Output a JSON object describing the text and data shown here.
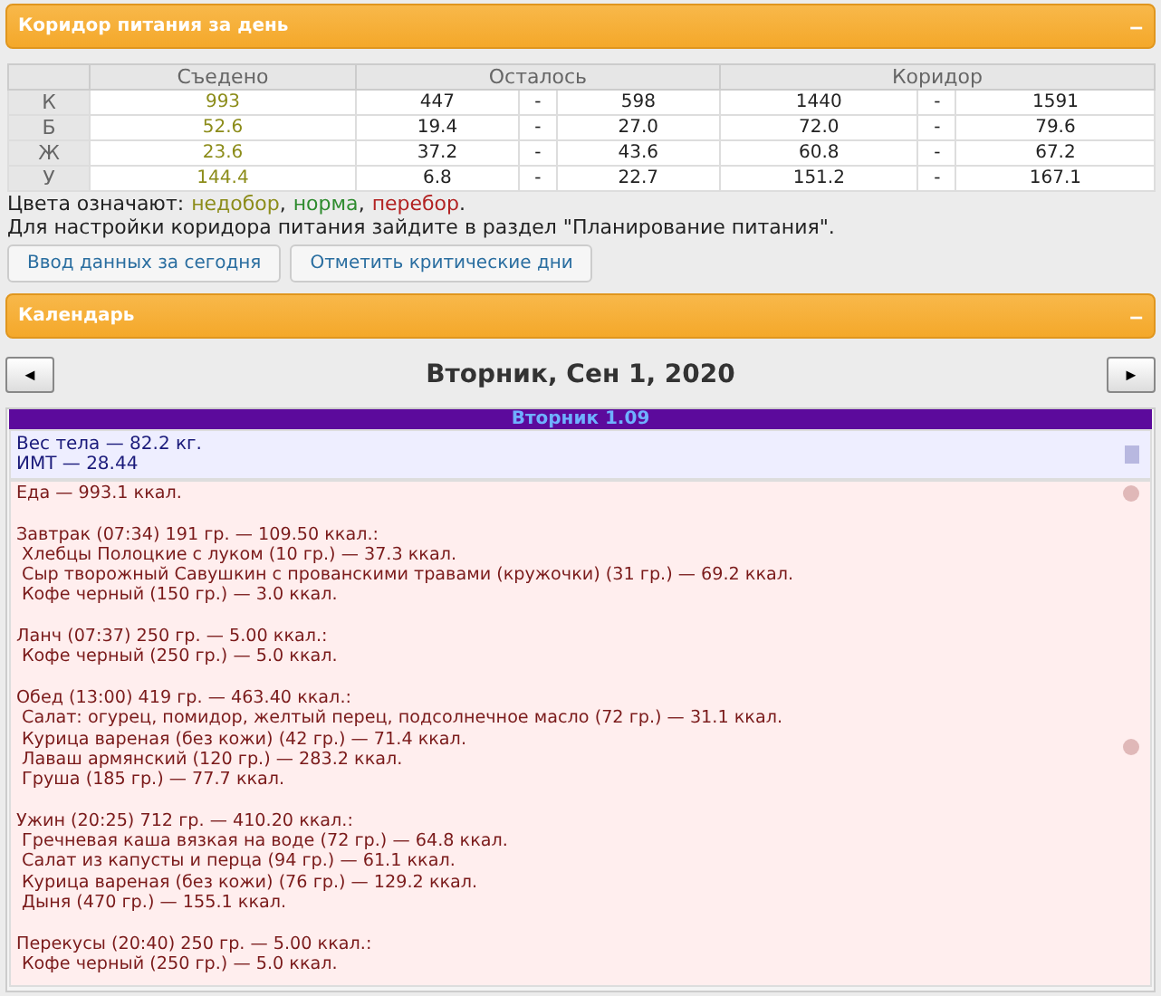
{
  "corridor_panel": {
    "title": "Коридор питания за день",
    "collapse": "–",
    "table": {
      "columns": [
        "Съедено",
        "Осталось",
        "Коридор"
      ],
      "rows": [
        {
          "label": "К",
          "eaten": "993",
          "color": "#8c8c1a",
          "left_min": "447",
          "left_sep": "-",
          "left_max": "598",
          "corr_min": "1440",
          "corr_sep": "-",
          "corr_max": "1591"
        },
        {
          "label": "Б",
          "eaten": "52.6",
          "color": "#8c8c1a",
          "left_min": "19.4",
          "left_sep": "-",
          "left_max": "27.0",
          "corr_min": "72.0",
          "corr_sep": "-",
          "corr_max": "79.6"
        },
        {
          "label": "Ж",
          "eaten": "23.6",
          "color": "#8c8c1a",
          "left_min": "37.2",
          "left_sep": "-",
          "left_max": "43.6",
          "corr_min": "60.8",
          "corr_sep": "-",
          "corr_max": "67.2"
        },
        {
          "label": "У",
          "eaten": "144.4",
          "color": "#8c8c1a",
          "left_min": "6.8",
          "left_sep": "-",
          "left_max": "22.7",
          "corr_min": "151.2",
          "corr_sep": "-",
          "corr_max": "167.1"
        }
      ]
    },
    "legend": {
      "prefix": "Цвета означают:",
      "items": [
        {
          "text": "недобор",
          "color": "#8c8c1a"
        },
        {
          "text": "норма",
          "color": "#2e8b2e"
        },
        {
          "text": "перебор",
          "color": "#b22222"
        }
      ],
      "separator": ",",
      "suffix": "."
    },
    "note": "Для настройки коридора питания зайдите в раздел \"Планирование питания\".",
    "buttons": [
      "Ввод данных за сегодня",
      "Отметить критические дни"
    ]
  },
  "calendar_panel": {
    "title": "Календарь",
    "collapse": "–",
    "prev": "◄",
    "next": "►",
    "date": "Вторник, Сен 1, 2020",
    "day_header": "Вторник 1.09",
    "body": [
      "Вес тела — 82.2 кг.",
      "ИМТ — 28.44"
    ],
    "food_total": "Еда — 993.1 ккал.",
    "meals": [
      {
        "title": "Завтрак (07:34) 191 гр. — 109.50 ккал.:",
        "items": [
          "Хлебцы Полоцкие с луком (10 гр.) — 37.3 ккал.",
          "Сыр творожный Савушкин с прованскими травами (кружочки) (31 гр.) — 69.2 ккал.",
          "Кофе черный (150 гр.) — 3.0 ккал."
        ]
      },
      {
        "title": "Ланч (07:37) 250 гр. — 5.00 ккал.:",
        "items": [
          "Кофе черный (250 гр.) — 5.0 ккал."
        ]
      },
      {
        "title": "Обед (13:00) 419 гр. — 463.40 ккал.:",
        "items": [
          "Салат: огурец, помидор, желтый перец, подсолнечное масло (72 гр.) — 31.1 ккал.",
          "Курица вареная (без кожи) (42 гр.) — 71.4 ккал.",
          "Лаваш армянский (120 гр.) — 283.2 ккал.",
          "Груша (185 гр.) — 77.7 ккал."
        ]
      },
      {
        "title": "Ужин (20:25) 712 гр. — 410.20 ккал.:",
        "items": [
          "Гречневая каша вязкая на воде (72 гр.) — 64.8 ккал.",
          "Салат из капусты и перца (94 гр.) — 61.1 ккал.",
          "Курица вареная (без кожи) (76 гр.) — 129.2 ккал.",
          "Дыня (470 гр.) — 155.1 ккал."
        ]
      },
      {
        "title": "Перекусы (20:40) 250 гр. — 5.00 ккал.:",
        "items": [
          "Кофе черный (250 гр.) — 5.0 ккал."
        ]
      }
    ]
  }
}
